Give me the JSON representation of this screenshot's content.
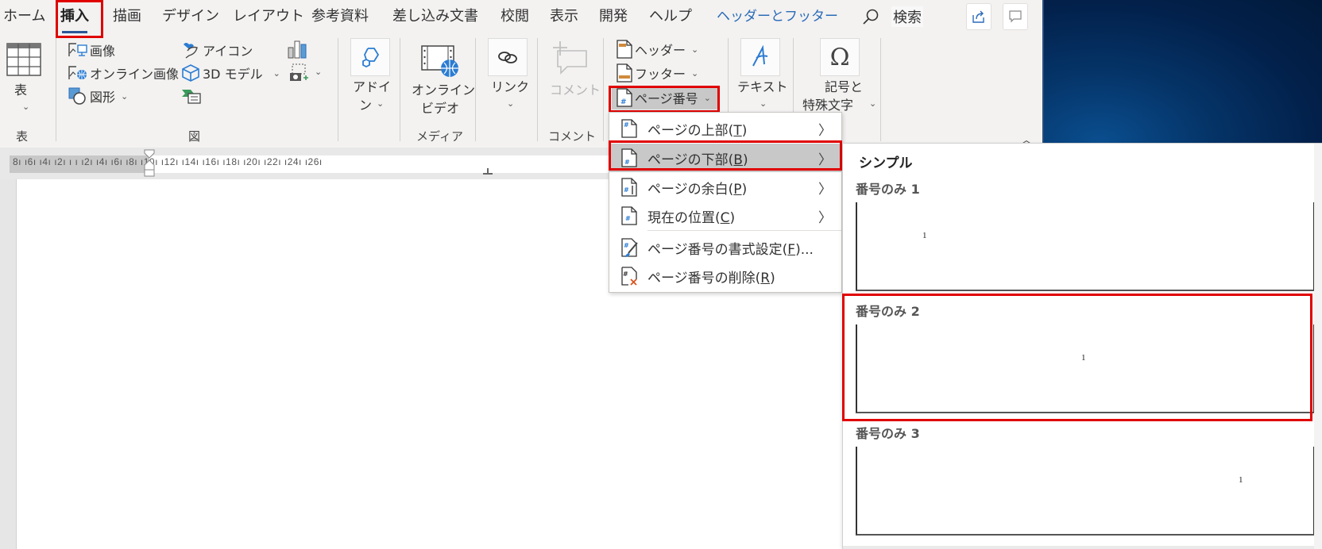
{
  "tabs": [
    {
      "label": "ホーム",
      "active": false
    },
    {
      "label": "挿入",
      "active": true
    },
    {
      "label": "描画",
      "active": false
    },
    {
      "label": "デザイン",
      "active": false
    },
    {
      "label": "レイアウト",
      "active": false
    },
    {
      "label": "参考資料",
      "active": false
    },
    {
      "label": "差し込み文書",
      "active": false
    },
    {
      "label": "校閲",
      "active": false
    },
    {
      "label": "表示",
      "active": false
    },
    {
      "label": "開発",
      "active": false
    },
    {
      "label": "ヘルプ",
      "active": false
    },
    {
      "label": "ヘッダーとフッター",
      "active": false,
      "contextual": true
    }
  ],
  "search": {
    "label": "検索",
    "icon": "search-icon"
  },
  "title_buttons": {
    "share_icon": "share-icon",
    "comments_icon": "comment-icon"
  },
  "ribbon": {
    "groups": {
      "table": {
        "label": "表",
        "button_label": "表"
      },
      "illustrations": {
        "label": "図",
        "items": {
          "pictures": "画像",
          "online_pictures": "オンライン画像",
          "shapes": "図形",
          "icons": "アイコン",
          "models_3d": "3D モデル"
        }
      },
      "addins": {
        "button_line1": "アドイ",
        "button_line2": "ン"
      },
      "media": {
        "label": "メディア",
        "button_line1": "オンライン",
        "button_line2": "ビデオ"
      },
      "links": {
        "button_label": "リンク"
      },
      "comments": {
        "label": "コメント",
        "button_label": "コメント"
      },
      "header_footer": {
        "header": "ヘッダー",
        "footer": "フッター",
        "page_number": "ページ番号"
      },
      "text": {
        "button_label": "テキスト"
      },
      "symbols": {
        "button_line1": "記号と",
        "button_line2": "特殊文字"
      }
    }
  },
  "ruler": {
    "labels": "8ı  ı6ı  ı4ı  ı2ı  ı    ı  ı2ı  ı4ı  ı6ı  ı8ı  ı10ı  ı12ı  ı14ı  ı16ı  ı18ı  ı20ı  ı22ı  ı24ı  ı26ı"
  },
  "page_number_menu": {
    "items": [
      {
        "label_pre": "ページの上部(",
        "accel": "T",
        "label_post": ")",
        "submenu": true,
        "highlighted": false,
        "icon": "page-top-number-icon"
      },
      {
        "label_pre": "ページの下部(",
        "accel": "B",
        "label_post": ")",
        "submenu": true,
        "highlighted": true,
        "icon": "page-bottom-number-icon"
      },
      {
        "label_pre": "ページの余白(",
        "accel": "P",
        "label_post": ")",
        "submenu": true,
        "highlighted": false,
        "icon": "page-margin-number-icon"
      },
      {
        "label_pre": "現在の位置(",
        "accel": "C",
        "label_post": ")",
        "submenu": true,
        "highlighted": false,
        "icon": "current-position-icon"
      },
      {
        "label_pre": "ページ番号の書式設定(",
        "accel": "F",
        "label_post": ")...",
        "submenu": false,
        "highlighted": false,
        "icon": "format-page-number-icon"
      },
      {
        "label_pre": "ページ番号の削除(",
        "accel": "R",
        "label_post": ")",
        "submenu": false,
        "highlighted": false,
        "icon": "remove-page-number-icon"
      }
    ]
  },
  "gallery": {
    "heading": "シンプル",
    "items": [
      {
        "title": "番号のみ 1",
        "number": "1",
        "align": "left",
        "selected": false
      },
      {
        "title": "番号のみ 2",
        "number": "1",
        "align": "center",
        "selected": true
      },
      {
        "title": "番号のみ 3",
        "number": "1",
        "align": "right",
        "selected": false
      }
    ]
  },
  "colors": {
    "accent": "#2b579a",
    "highlight_box": "#e00000",
    "contextual_tab": "#2b6cb8"
  }
}
